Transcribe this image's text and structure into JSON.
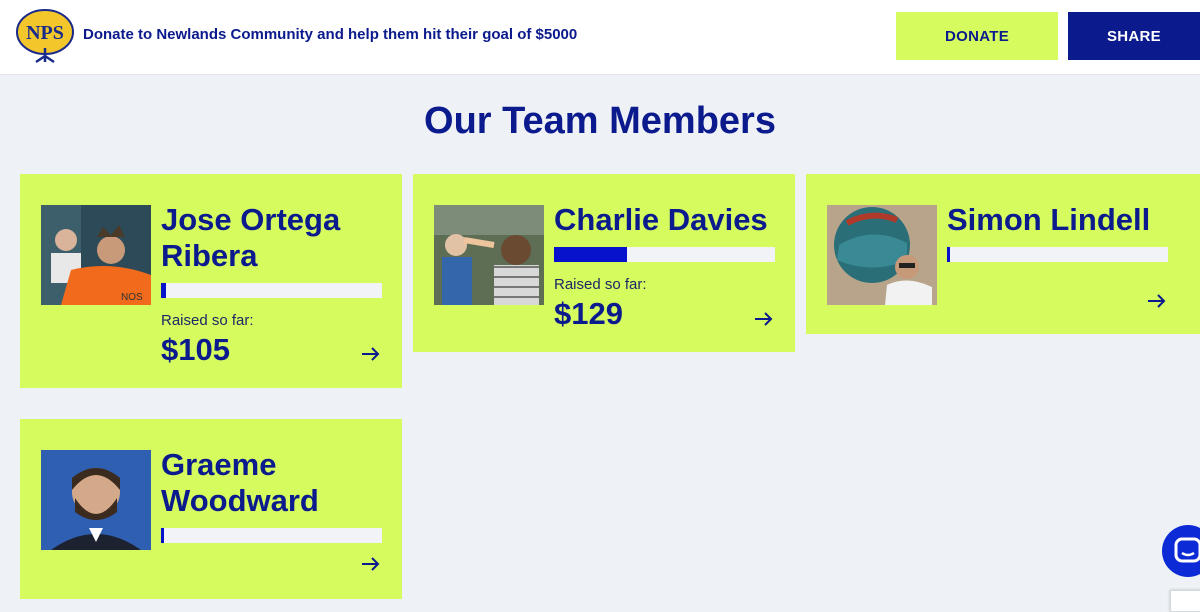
{
  "header": {
    "logo_text": "NPS",
    "message": "Donate to Newlands Community and help them hit their goal of $5000",
    "donate_label": "DONATE",
    "share_label": "SHARE"
  },
  "section": {
    "title": "Our Team Members"
  },
  "members": [
    {
      "name": "Jose Ortega Ribera",
      "raised_label": "Raised so far:",
      "raised_amount": "$105",
      "progress": 0.021
    },
    {
      "name": "Charlie Davies",
      "raised_label": "Raised so far:",
      "raised_amount": "$129",
      "progress": 0.33
    },
    {
      "name": "Simon Lindell",
      "progress": 0.005
    },
    {
      "name": "Graeme Woodward",
      "progress": 0.005
    }
  ],
  "colors": {
    "brand_navy": "#0b1a8c",
    "accent_lime": "#d6fb5e",
    "progress_blue": "#0712cc",
    "background": "#eef1f5"
  },
  "icons": {
    "arrow": "arrow-right-icon",
    "chat": "chat-icon"
  }
}
